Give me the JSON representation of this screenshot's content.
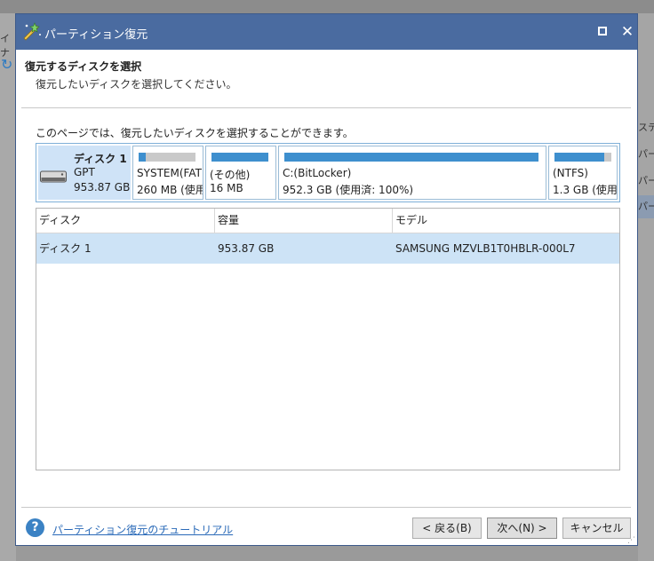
{
  "background": {
    "left_fragment": "イナ",
    "right_items": [
      "ステ",
      "パー",
      "パー",
      "パー"
    ]
  },
  "window": {
    "title": "パーティション復元"
  },
  "header": {
    "heading": "復元するディスクを選択",
    "subheading": "復元したいディスクを選択してください。"
  },
  "instruction": "このページでは、復元したいディスクを選択することができます。",
  "disk_map": {
    "disk": {
      "name": "ディスク 1",
      "type": "GPT",
      "size": "953.87 GB"
    },
    "partitions": [
      {
        "name": "SYSTEM(FAT",
        "size": "260 MB (使用",
        "usage": 0.12
      },
      {
        "name": "(その他)",
        "size": "16 MB",
        "usage": 1.0
      },
      {
        "name": "C:(BitLocker)",
        "size": "952.3 GB (使用済: 100%)",
        "usage": 1.0
      },
      {
        "name": "(NTFS)",
        "size": "1.3 GB (使用",
        "usage": 0.88
      }
    ]
  },
  "table": {
    "columns": [
      "ディスク",
      "容量",
      "モデル"
    ],
    "rows": [
      {
        "disk": "ディスク 1",
        "capacity": "953.87 GB",
        "model": "SAMSUNG MZVLB1T0HBLR-000L7"
      }
    ]
  },
  "footer": {
    "help_link": "パーティション復元のチュートリアル",
    "back_label": "< 戻る(B)",
    "next_label": "次へ(N) >",
    "cancel_label": "キャンセル"
  }
}
